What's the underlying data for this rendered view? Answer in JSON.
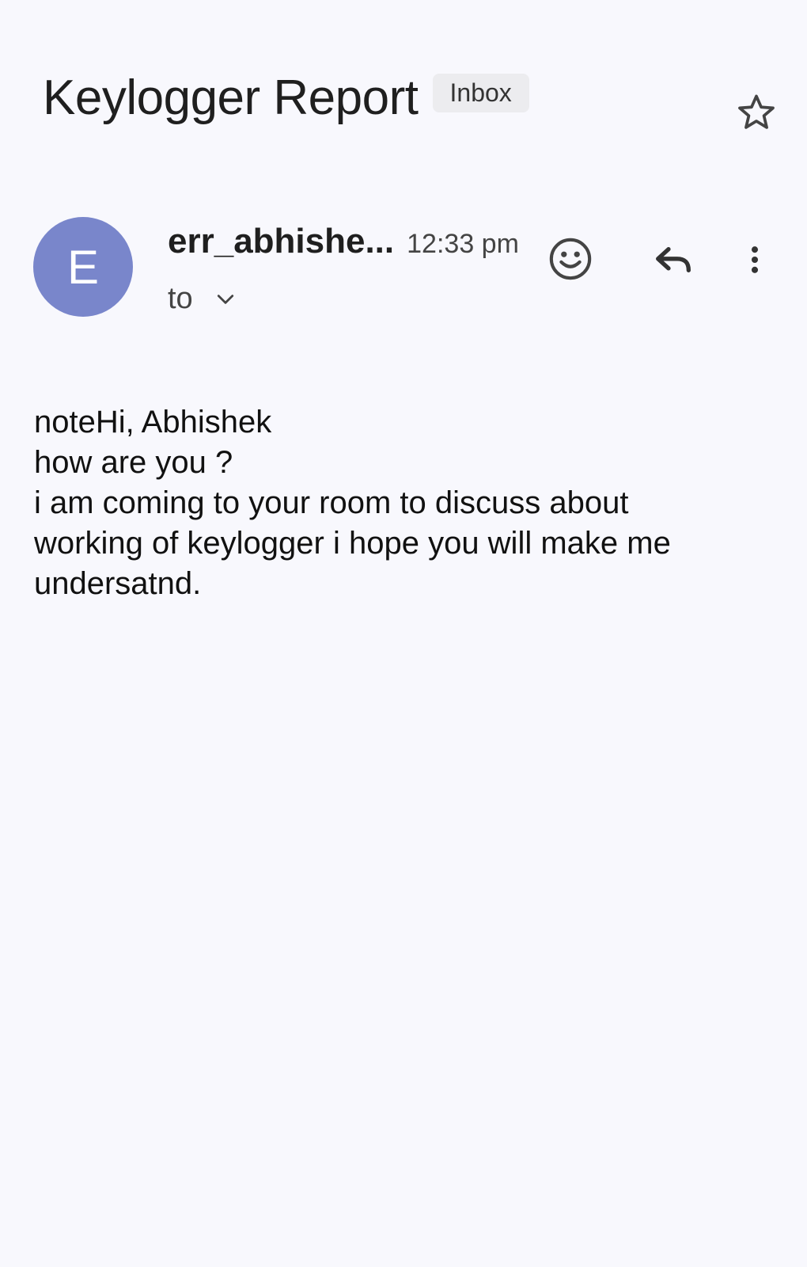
{
  "email": {
    "subject": "Keylogger Report",
    "label": "Inbox",
    "sender": {
      "avatar_letter": "E",
      "avatar_color": "#7986cb",
      "name": "err_abhishe...",
      "time": "12:33 pm",
      "to_label": "to"
    },
    "body_lines": [
      "noteHi, Abhishek",
      "how are you ?",
      "i am coming to your room to discuss about",
      "working of keylogger i hope you will make me",
      "undersatnd."
    ]
  },
  "icons": {
    "star": "star-outline-icon",
    "emoji": "add-reaction-icon",
    "reply": "reply-icon",
    "more": "more-vert-icon",
    "recipients": "chevron-down-icon"
  },
  "colors": {
    "background": "#f8f8fd",
    "chip_background": "#ececef",
    "icon": "#444444"
  }
}
